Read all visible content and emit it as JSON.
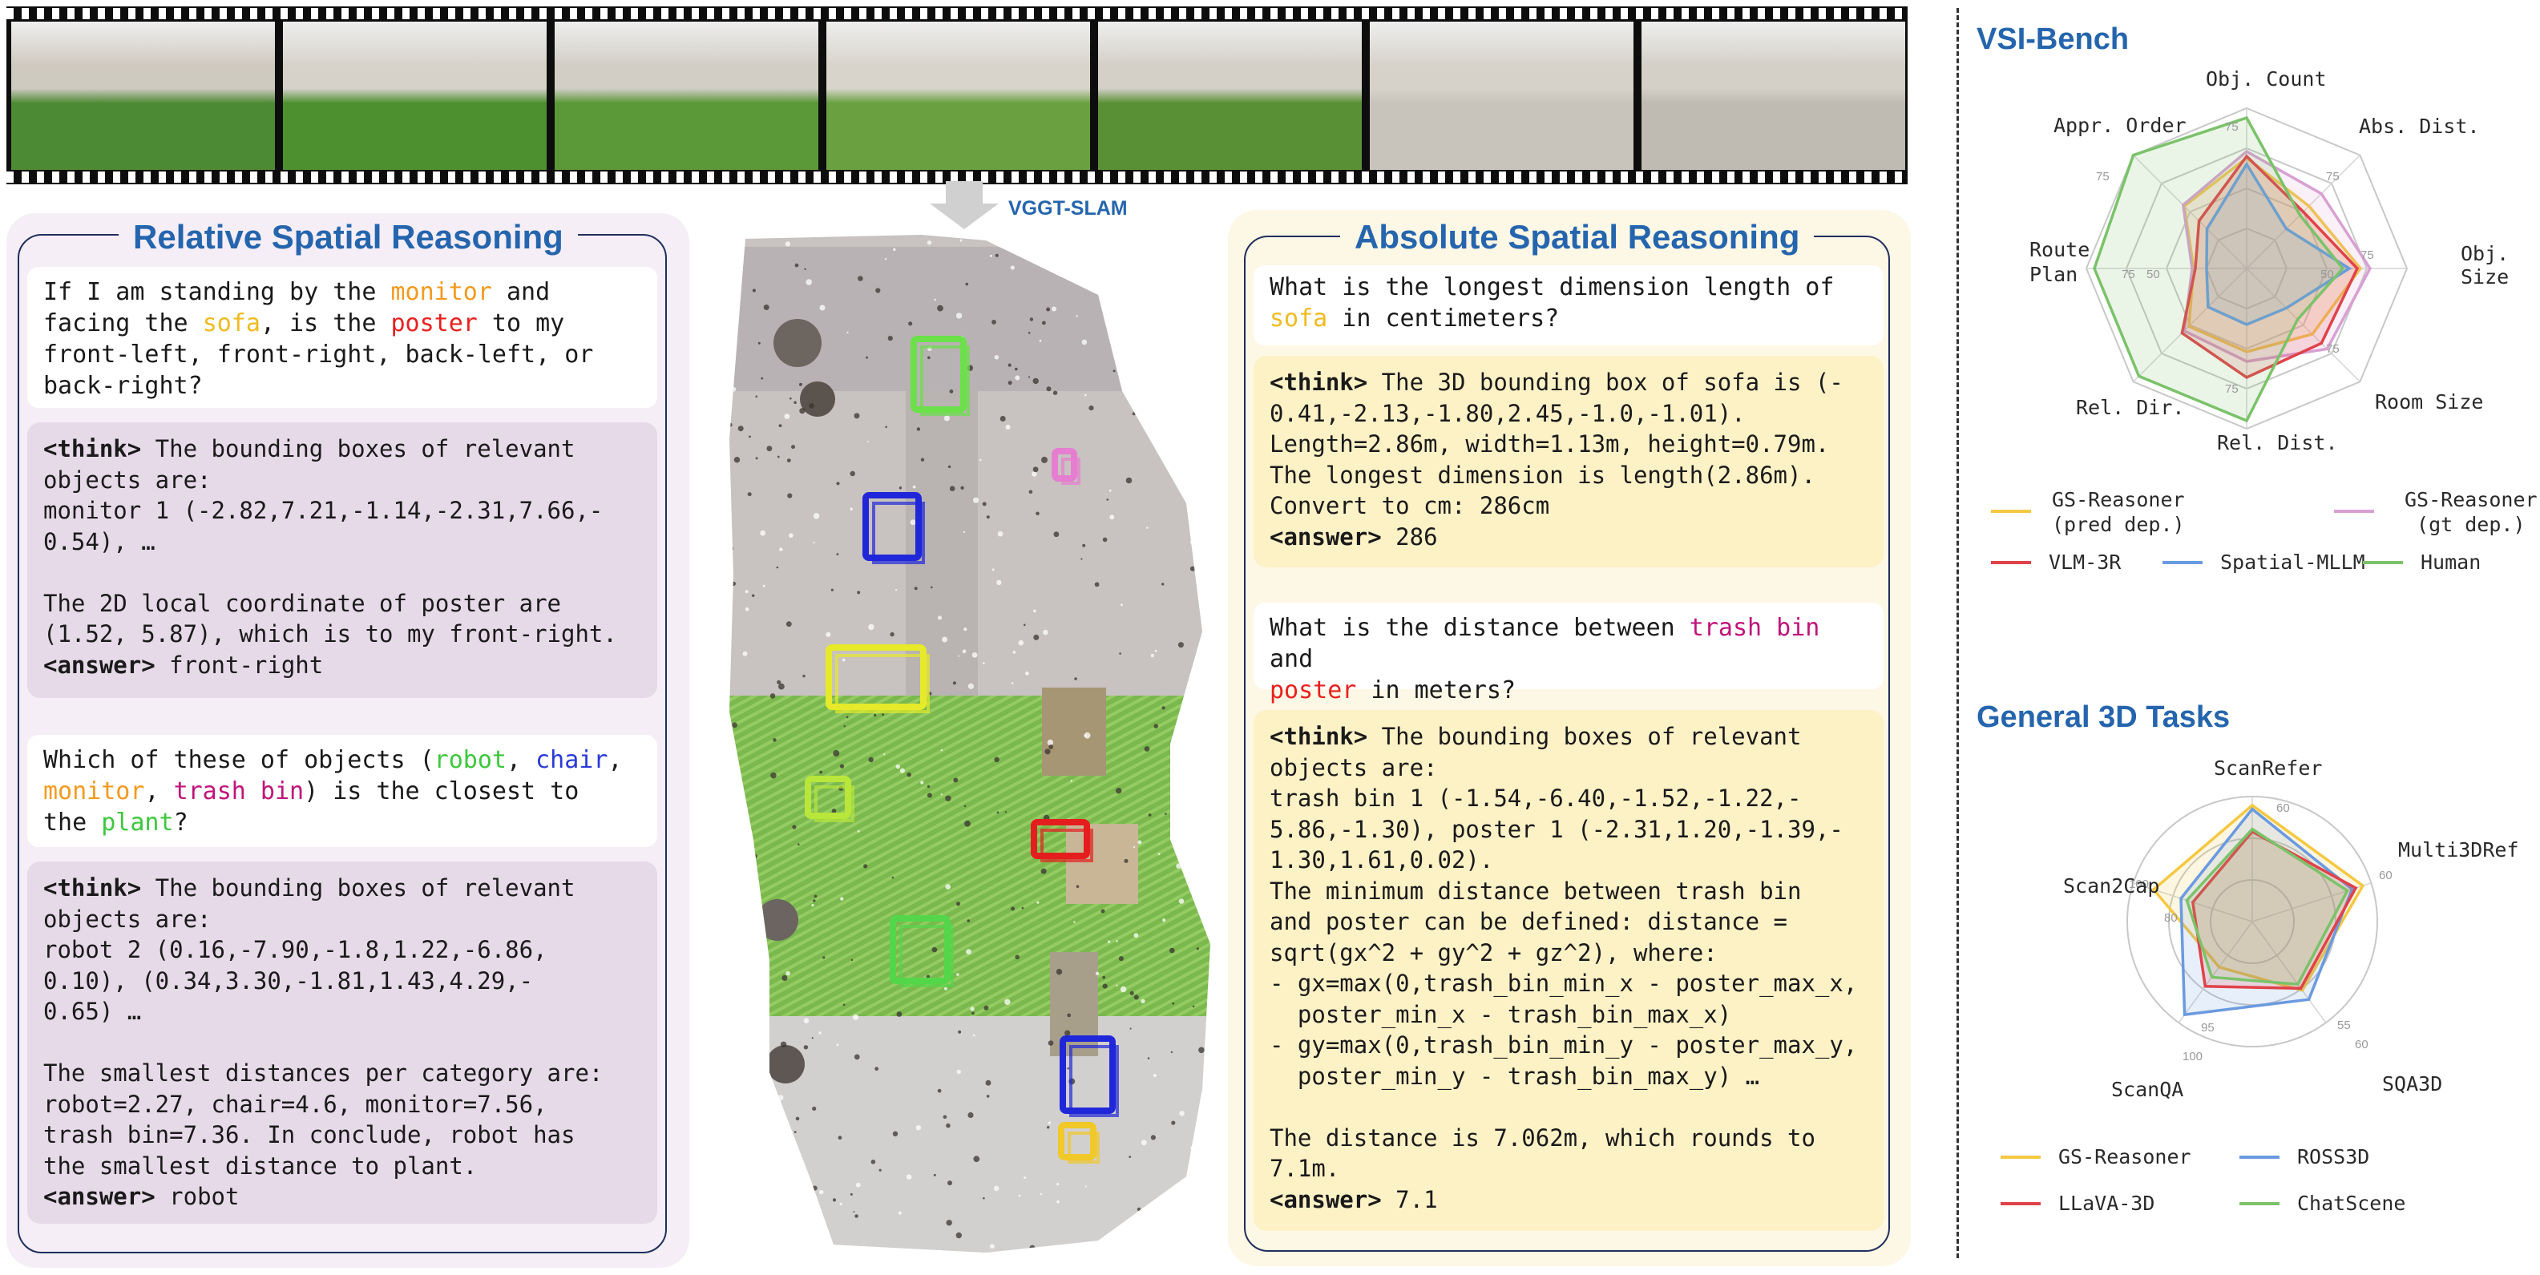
{
  "filmstrip": {
    "frames": [
      {
        "floor": "#4d8a34",
        "wall": "#cfcac0"
      },
      {
        "floor": "#4d9030",
        "wall": "#d6d2ca"
      },
      {
        "floor": "#5b9838",
        "wall": "#d2cec6"
      },
      {
        "floor": "#6aa040",
        "wall": "#d8d4cc"
      },
      {
        "floor": "#5a9035",
        "wall": "#d4d0c8"
      },
      {
        "floor": "#c8c4bc",
        "wall": "#d6d2ca"
      },
      {
        "floor": "#bfbab2",
        "wall": "#d4d0c8"
      }
    ]
  },
  "arrow_label": "VGGT-SLAM",
  "relative": {
    "title": "Relative Spatial Reasoning",
    "q1": [
      {
        "t": "If I am standing by the "
      },
      {
        "t": "monitor",
        "c": "c-orange"
      },
      {
        "t": " and\nfacing the "
      },
      {
        "t": "sofa",
        "c": "c-yellow"
      },
      {
        "t": ", is the "
      },
      {
        "t": "poster",
        "c": "c-red"
      },
      {
        "t": " to my\nfront-left, front-right, back-left, or\nback-right?"
      }
    ],
    "a1": [
      {
        "t": "<think>",
        "b": true
      },
      {
        "t": " The bounding boxes of relevant\nobjects are:\nmonitor 1 (-2.82,7.21,-1.14,-2.31,7.66,-\n0.54), …\n\nThe 2D local coordinate of poster are\n(1.52, 5.87), which is to my front-right.\n"
      },
      {
        "t": "<answer>",
        "b": true
      },
      {
        "t": " front-right"
      }
    ],
    "q2": [
      {
        "t": "Which of these of objects ("
      },
      {
        "t": "robot",
        "c": "c-green"
      },
      {
        "t": ", "
      },
      {
        "t": "chair",
        "c": "c-blue"
      },
      {
        "t": ",\n"
      },
      {
        "t": "monitor",
        "c": "c-orange"
      },
      {
        "t": ", "
      },
      {
        "t": "trash bin",
        "c": "c-magenta"
      },
      {
        "t": ") is the closest to\nthe "
      },
      {
        "t": "plant",
        "c": "c-green"
      },
      {
        "t": "?"
      }
    ],
    "a2": [
      {
        "t": "<think>",
        "b": true
      },
      {
        "t": " The bounding boxes of relevant\nobjects are:\nrobot 2 (0.16,-7.90,-1.8,1.22,-6.86,\n0.10), (0.34,3.30,-1.81,1.43,4.29,-\n0.65) …\n\nThe smallest distances per category are:\nrobot=2.27, chair=4.6, monitor=7.56,\ntrash bin=7.36. In conclude, robot has\nthe smallest distance to plant.\n"
      },
      {
        "t": "<answer>",
        "b": true
      },
      {
        "t": " robot"
      }
    ]
  },
  "absolute": {
    "title": "Absolute Spatial Reasoning",
    "q1": [
      {
        "t": "What is the longest dimension length of\n"
      },
      {
        "t": "sofa",
        "c": "c-yellow"
      },
      {
        "t": " in centimeters?"
      }
    ],
    "a1": [
      {
        "t": "<think>",
        "b": true
      },
      {
        "t": " The 3D bounding box of sofa is (-\n0.41,-2.13,-1.80,2.45,-1.0,-1.01).\nLength=2.86m, width=1.13m, height=0.79m.\nThe longest dimension is length(2.86m).\nConvert to cm: 286cm\n"
      },
      {
        "t": "<answer>",
        "b": true
      },
      {
        "t": " 286"
      }
    ],
    "q2": [
      {
        "t": "What is the distance between "
      },
      {
        "t": "trash bin",
        "c": "c-magenta"
      },
      {
        "t": " and\n"
      },
      {
        "t": "poster",
        "c": "c-red"
      },
      {
        "t": " in meters?"
      }
    ],
    "a2": [
      {
        "t": "<think>",
        "b": true
      },
      {
        "t": " The bounding boxes of relevant\nobjects are:\ntrash bin 1 (-1.54,-6.40,-1.52,-1.22,-\n5.86,-1.30), poster 1 (-2.31,1.20,-1.39,-\n1.30,1.61,0.02).\nThe minimum distance between trash bin\nand poster can be defined: distance =\nsqrt(gx^2 + gy^2 + gz^2), where:\n- gx=max(0,trash_bin_min_x - poster_max_x,\n  poster_min_x - trash_bin_max_x)\n- gy=max(0,trash_bin_min_y - poster_max_y,\n  poster_min_y - trash_bin_max_y) …\n\nThe distance is 7.062m, which rounds to\n7.1m.\n"
      },
      {
        "t": "<answer>",
        "b": true
      },
      {
        "t": " 7.1"
      }
    ]
  },
  "pointcloud_boxes": [
    {
      "color": "#6be04a"
    },
    {
      "color": "#e57ed0"
    },
    {
      "color": "#2027d8"
    },
    {
      "color": "#e6ea2a"
    },
    {
      "color": "#b8e63a"
    },
    {
      "color": "#e41e1e"
    },
    {
      "color": "#54d64a"
    },
    {
      "color": "#2027d8"
    },
    {
      "color": "#f0c828"
    }
  ],
  "chart_data": [
    {
      "type": "radar",
      "title": "VSI-Bench",
      "axes": [
        "Obj. Count",
        "Abs. Dist.",
        "Obj. Size",
        "Room Size",
        "Rel. Dist.",
        "Rel. Dir.",
        "Route Plan",
        "Appr. Order"
      ],
      "rmax": 100,
      "ring_values": [
        25,
        50,
        75
      ],
      "series": [
        {
          "name": "GS-Reasoner (pred dep.)",
          "color": "#f5c842",
          "values": [
            69,
            55,
            71,
            58,
            52,
            51,
            33,
            55
          ]
        },
        {
          "name": "GS-Reasoner (gt dep.)",
          "color": "#d8a0d2",
          "values": [
            73,
            66,
            77,
            71,
            58,
            55,
            34,
            56
          ]
        },
        {
          "name": "VLM-3R",
          "color": "#e0424a",
          "values": [
            70,
            50,
            69,
            66,
            68,
            57,
            32,
            42
          ]
        },
        {
          "name": "Spatial-MLLM",
          "color": "#6a9ae0",
          "values": [
            65,
            35,
            64,
            35,
            35,
            34,
            25,
            35
          ]
        },
        {
          "name": "Human",
          "color": "#7bc26a",
          "values": [
            94,
            47,
            60,
            45,
            95,
            95,
            95,
            100
          ]
        }
      ]
    },
    {
      "type": "radar",
      "title": "General 3D Tasks",
      "axes": [
        "ScanRefer",
        "Multi3DRef",
        "SQA3D",
        "ScanQA",
        "Scan2Cap"
      ],
      "series": [
        {
          "name": "GS-Reasoner",
          "color": "#f5c842",
          "values": [
            0.93,
            0.93,
            0.68,
            0.45,
            0.83
          ]
        },
        {
          "name": "ROSS3D",
          "color": "#6a9ae0",
          "values": [
            0.9,
            0.84,
            0.77,
            0.92,
            0.6
          ]
        },
        {
          "name": "LLaVA-3D",
          "color": "#e0424a",
          "values": [
            0.72,
            0.87,
            0.66,
            0.64,
            0.5
          ]
        },
        {
          "name": "ChatScene",
          "color": "#7bc26a",
          "values": [
            0.74,
            0.8,
            0.62,
            0.55,
            0.55
          ]
        }
      ]
    }
  ],
  "radar1_ticks": {
    "t75a": "75",
    "t75b": "75",
    "t75c": "75",
    "t75d": "75",
    "t75e": "75",
    "t75f": "75",
    "t50a": "50",
    "t50b": "50",
    "t50c": "50"
  },
  "radar2_ticks": {
    "t60a": "60",
    "t60b": "60",
    "t60c": "60",
    "t100a": "100",
    "t100b": "100",
    "t80": "80",
    "t95": "95",
    "t55": "55"
  },
  "legend1": {
    "gs_pred": "GS-Reasoner\n(pred dep.)",
    "gs_gt": "GS-Reasoner\n(gt dep.)",
    "vlm": "VLM-3R",
    "sp": "Spatial-MLLM",
    "human": "Human"
  },
  "legend2": {
    "gs": "GS-Reasoner",
    "ross": "ROSS3D",
    "llava": "LLaVA-3D",
    "chat": "ChatScene"
  }
}
